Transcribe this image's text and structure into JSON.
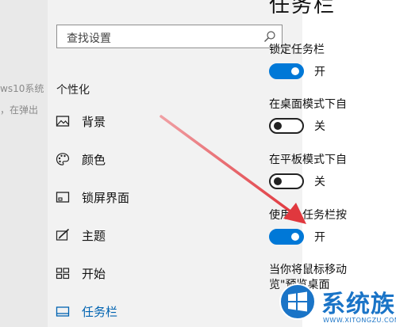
{
  "background_article": {
    "line1": "ws10系统",
    "line2": "，在弹出"
  },
  "search": {
    "placeholder": "查找设置"
  },
  "sidebar": {
    "section_label": "个性化",
    "items": [
      {
        "label": "背景",
        "icon": "image-icon"
      },
      {
        "label": "颜色",
        "icon": "palette-icon"
      },
      {
        "label": "锁屏界面",
        "icon": "lock-screen-icon"
      },
      {
        "label": "主题",
        "icon": "theme-brush-icon"
      },
      {
        "label": "开始",
        "icon": "start-tiles-icon"
      },
      {
        "label": "任务栏",
        "icon": "taskbar-icon",
        "active": true
      }
    ]
  },
  "main": {
    "title": "任务栏",
    "settings": [
      {
        "label": "锁定任务栏",
        "state": "on",
        "state_label": "开"
      },
      {
        "label": "在桌面模式下自",
        "state": "off",
        "state_label": "关"
      },
      {
        "label": "在平板模式下自",
        "state": "off",
        "state_label": "关"
      },
      {
        "label": "使用小任务栏按",
        "state": "on",
        "state_label": "开"
      }
    ],
    "extra_line1": "当你将鼠标移动",
    "extra_line2": "览\"预览桌面"
  },
  "watermark": {
    "brand": "系统族",
    "url": "WWW.XITONGZU.COM"
  },
  "colors": {
    "accent": "#0078d7",
    "arrow": "#e0383e",
    "sidebar_bg": "#f2f2f2"
  }
}
